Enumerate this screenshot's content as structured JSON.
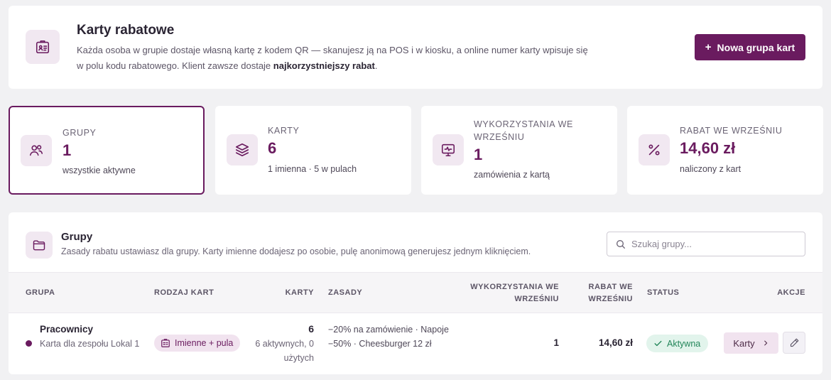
{
  "header": {
    "title": "Karty rabatowe",
    "description_1": "Każda osoba w grupie dostaje własną kartę z kodem QR — skanujesz ją na POS i w kiosku, a online numer karty wpisuje się w polu kodu rabatowego. Klient zawsze dostaje ",
    "description_bold": "najkorzystniejszy rabat",
    "description_2": ".",
    "new_button_label": "Nowa grupa kart"
  },
  "stats": [
    {
      "label": "GRUPY",
      "value": "1",
      "sub": "wszystkie aktywne"
    },
    {
      "label": "KARTY",
      "value": "6",
      "sub": "1 imienna · 5 w pulach"
    },
    {
      "label": "WYKORZYSTANIA WE WRZEŚNIU",
      "value": "1",
      "sub": "zamówienia z kartą"
    },
    {
      "label": "RABAT WE WRZEŚNIU",
      "value": "14,60 zł",
      "sub": "naliczony z kart"
    }
  ],
  "groups": {
    "title": "Grupy",
    "description": "Zasady rabatu ustawiasz dla grupy. Karty imienne dodajesz po osobie, pulę anonimową generujesz jednym kliknięciem.",
    "search_placeholder": "Szukaj grupy...",
    "columns": {
      "group": "GRUPA",
      "card_type": "RODZAJ KART",
      "cards": "KARTY",
      "rules": "ZASADY",
      "uses": "WYKORZYSTANIA WE WRZEŚNIU",
      "discount": "RABAT WE WRZEŚNIU",
      "status": "STATUS",
      "actions": "AKCJE"
    },
    "rows": [
      {
        "name": "Pracownicy",
        "subtitle": "Karta dla zespołu Lokal 1",
        "card_type": "Imienne + pula",
        "cards_count": "6",
        "cards_detail": "6 aktywnych, 0 użytych",
        "rules": "−20% na zamówienie · Napoje −50% · Cheesburger 12 zł",
        "uses": "1",
        "discount": "14,60 zł",
        "status": "Aktywna",
        "cards_button": "Karty"
      }
    ]
  },
  "colors": {
    "accent": "#6a1b5f",
    "icon_bg": "#f1e8f1",
    "status_bg": "#e2f4ec",
    "status_text": "#23865a"
  },
  "icons": {
    "header": "id-badge-icon",
    "stat_groups": "users-icon",
    "stat_cards": "layers-icon",
    "stat_uses": "monitor-pulse-icon",
    "stat_discount": "percent-icon",
    "groups": "folder-icon"
  }
}
